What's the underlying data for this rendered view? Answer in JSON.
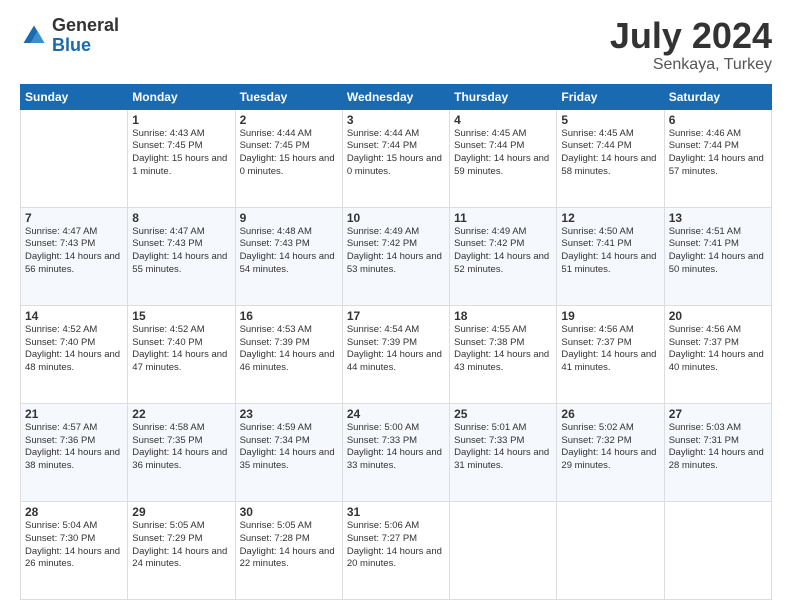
{
  "logo": {
    "general": "General",
    "blue": "Blue"
  },
  "title": "July 2024",
  "subtitle": "Senkaya, Turkey",
  "headers": [
    "Sunday",
    "Monday",
    "Tuesday",
    "Wednesday",
    "Thursday",
    "Friday",
    "Saturday"
  ],
  "weeks": [
    [
      {
        "day": "",
        "sunrise": "",
        "sunset": "",
        "daylight": ""
      },
      {
        "day": "1",
        "sunrise": "Sunrise: 4:43 AM",
        "sunset": "Sunset: 7:45 PM",
        "daylight": "Daylight: 15 hours and 1 minute."
      },
      {
        "day": "2",
        "sunrise": "Sunrise: 4:44 AM",
        "sunset": "Sunset: 7:45 PM",
        "daylight": "Daylight: 15 hours and 0 minutes."
      },
      {
        "day": "3",
        "sunrise": "Sunrise: 4:44 AM",
        "sunset": "Sunset: 7:44 PM",
        "daylight": "Daylight: 15 hours and 0 minutes."
      },
      {
        "day": "4",
        "sunrise": "Sunrise: 4:45 AM",
        "sunset": "Sunset: 7:44 PM",
        "daylight": "Daylight: 14 hours and 59 minutes."
      },
      {
        "day": "5",
        "sunrise": "Sunrise: 4:45 AM",
        "sunset": "Sunset: 7:44 PM",
        "daylight": "Daylight: 14 hours and 58 minutes."
      },
      {
        "day": "6",
        "sunrise": "Sunrise: 4:46 AM",
        "sunset": "Sunset: 7:44 PM",
        "daylight": "Daylight: 14 hours and 57 minutes."
      }
    ],
    [
      {
        "day": "7",
        "sunrise": "Sunrise: 4:47 AM",
        "sunset": "Sunset: 7:43 PM",
        "daylight": "Daylight: 14 hours and 56 minutes."
      },
      {
        "day": "8",
        "sunrise": "Sunrise: 4:47 AM",
        "sunset": "Sunset: 7:43 PM",
        "daylight": "Daylight: 14 hours and 55 minutes."
      },
      {
        "day": "9",
        "sunrise": "Sunrise: 4:48 AM",
        "sunset": "Sunset: 7:43 PM",
        "daylight": "Daylight: 14 hours and 54 minutes."
      },
      {
        "day": "10",
        "sunrise": "Sunrise: 4:49 AM",
        "sunset": "Sunset: 7:42 PM",
        "daylight": "Daylight: 14 hours and 53 minutes."
      },
      {
        "day": "11",
        "sunrise": "Sunrise: 4:49 AM",
        "sunset": "Sunset: 7:42 PM",
        "daylight": "Daylight: 14 hours and 52 minutes."
      },
      {
        "day": "12",
        "sunrise": "Sunrise: 4:50 AM",
        "sunset": "Sunset: 7:41 PM",
        "daylight": "Daylight: 14 hours and 51 minutes."
      },
      {
        "day": "13",
        "sunrise": "Sunrise: 4:51 AM",
        "sunset": "Sunset: 7:41 PM",
        "daylight": "Daylight: 14 hours and 50 minutes."
      }
    ],
    [
      {
        "day": "14",
        "sunrise": "Sunrise: 4:52 AM",
        "sunset": "Sunset: 7:40 PM",
        "daylight": "Daylight: 14 hours and 48 minutes."
      },
      {
        "day": "15",
        "sunrise": "Sunrise: 4:52 AM",
        "sunset": "Sunset: 7:40 PM",
        "daylight": "Daylight: 14 hours and 47 minutes."
      },
      {
        "day": "16",
        "sunrise": "Sunrise: 4:53 AM",
        "sunset": "Sunset: 7:39 PM",
        "daylight": "Daylight: 14 hours and 46 minutes."
      },
      {
        "day": "17",
        "sunrise": "Sunrise: 4:54 AM",
        "sunset": "Sunset: 7:39 PM",
        "daylight": "Daylight: 14 hours and 44 minutes."
      },
      {
        "day": "18",
        "sunrise": "Sunrise: 4:55 AM",
        "sunset": "Sunset: 7:38 PM",
        "daylight": "Daylight: 14 hours and 43 minutes."
      },
      {
        "day": "19",
        "sunrise": "Sunrise: 4:56 AM",
        "sunset": "Sunset: 7:37 PM",
        "daylight": "Daylight: 14 hours and 41 minutes."
      },
      {
        "day": "20",
        "sunrise": "Sunrise: 4:56 AM",
        "sunset": "Sunset: 7:37 PM",
        "daylight": "Daylight: 14 hours and 40 minutes."
      }
    ],
    [
      {
        "day": "21",
        "sunrise": "Sunrise: 4:57 AM",
        "sunset": "Sunset: 7:36 PM",
        "daylight": "Daylight: 14 hours and 38 minutes."
      },
      {
        "day": "22",
        "sunrise": "Sunrise: 4:58 AM",
        "sunset": "Sunset: 7:35 PM",
        "daylight": "Daylight: 14 hours and 36 minutes."
      },
      {
        "day": "23",
        "sunrise": "Sunrise: 4:59 AM",
        "sunset": "Sunset: 7:34 PM",
        "daylight": "Daylight: 14 hours and 35 minutes."
      },
      {
        "day": "24",
        "sunrise": "Sunrise: 5:00 AM",
        "sunset": "Sunset: 7:33 PM",
        "daylight": "Daylight: 14 hours and 33 minutes."
      },
      {
        "day": "25",
        "sunrise": "Sunrise: 5:01 AM",
        "sunset": "Sunset: 7:33 PM",
        "daylight": "Daylight: 14 hours and 31 minutes."
      },
      {
        "day": "26",
        "sunrise": "Sunrise: 5:02 AM",
        "sunset": "Sunset: 7:32 PM",
        "daylight": "Daylight: 14 hours and 29 minutes."
      },
      {
        "day": "27",
        "sunrise": "Sunrise: 5:03 AM",
        "sunset": "Sunset: 7:31 PM",
        "daylight": "Daylight: 14 hours and 28 minutes."
      }
    ],
    [
      {
        "day": "28",
        "sunrise": "Sunrise: 5:04 AM",
        "sunset": "Sunset: 7:30 PM",
        "daylight": "Daylight: 14 hours and 26 minutes."
      },
      {
        "day": "29",
        "sunrise": "Sunrise: 5:05 AM",
        "sunset": "Sunset: 7:29 PM",
        "daylight": "Daylight: 14 hours and 24 minutes."
      },
      {
        "day": "30",
        "sunrise": "Sunrise: 5:05 AM",
        "sunset": "Sunset: 7:28 PM",
        "daylight": "Daylight: 14 hours and 22 minutes."
      },
      {
        "day": "31",
        "sunrise": "Sunrise: 5:06 AM",
        "sunset": "Sunset: 7:27 PM",
        "daylight": "Daylight: 14 hours and 20 minutes."
      },
      {
        "day": "",
        "sunrise": "",
        "sunset": "",
        "daylight": ""
      },
      {
        "day": "",
        "sunrise": "",
        "sunset": "",
        "daylight": ""
      },
      {
        "day": "",
        "sunrise": "",
        "sunset": "",
        "daylight": ""
      }
    ]
  ]
}
